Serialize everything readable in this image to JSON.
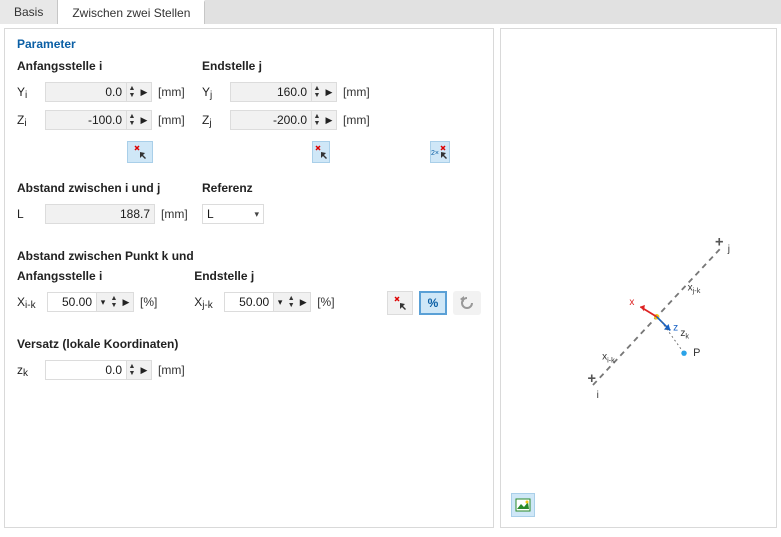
{
  "tabs": {
    "basis": "Basis",
    "between": "Zwischen zwei Stellen"
  },
  "sectionHeader": "Parameter",
  "start": {
    "head": "Anfangsstelle i",
    "yLabel": "Yᵢ",
    "yValue": "0.0",
    "yUnit": "[mm]",
    "zLabel": "Zᵢ",
    "zValue": "-100.0",
    "zUnit": "[mm]"
  },
  "end": {
    "head": "Endstelle j",
    "yLabel": "Yⱼ",
    "yValue": "160.0",
    "yUnit": "[mm]",
    "zLabel": "Zⱼ",
    "zValue": "-200.0",
    "zUnit": "[mm]"
  },
  "distIJ": {
    "head": "Abstand zwischen i und j",
    "lLabel": "L",
    "lValue": "188.7",
    "lUnit": "[mm]"
  },
  "ref": {
    "head": "Referenz",
    "value": "L"
  },
  "distK": {
    "head": "Abstand zwischen Punkt k und"
  },
  "kStart": {
    "head": "Anfangsstelle i",
    "xLabel": "Xi-k",
    "value": "50.00",
    "unit": "[%]"
  },
  "kEnd": {
    "head": "Endstelle j",
    "xLabel": "Xj-k",
    "value": "50.00",
    "unit": "[%]"
  },
  "percentIcon": "%",
  "offset": {
    "head": "Versatz (lokale Koordinaten)",
    "zLabel": "zₖ",
    "value": "0.0",
    "unit": "[mm]"
  },
  "diagram": {
    "i": "i",
    "j": "j",
    "xik": "xᵢ₋ₖ",
    "xjk": "xⱼ₋ₖ",
    "x": "x",
    "z": "z",
    "zk": "zₖ",
    "P": "P"
  }
}
